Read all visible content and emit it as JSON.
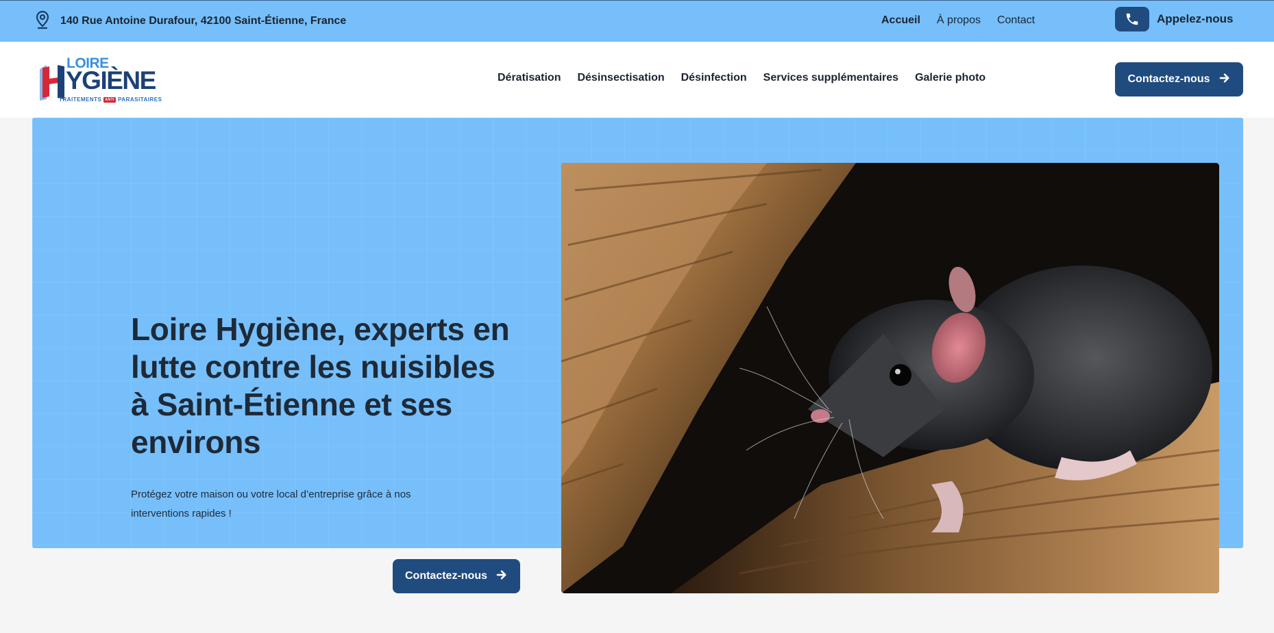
{
  "topbar": {
    "address": "140 Rue Antoine Durafour, 42100 Saint-Étienne, France",
    "nav": [
      "Accueil",
      "À propos",
      "Contact"
    ],
    "call_label": "Appelez-nous"
  },
  "logo": {
    "line1": "LOIRE",
    "line2": "YGIÈNE",
    "tag_left": "TRAITEMENTS",
    "tag_mid": "ANTI",
    "tag_right": "PARASITAIRES"
  },
  "mainnav": [
    "Dératisation",
    "Désinsectisation",
    "Désinfection",
    "Services supplémentaires",
    "Galerie photo"
  ],
  "header_cta": "Contactez-nous",
  "hero": {
    "title": "Loire Hygiène, experts en lutte contre les nuisibles à Saint-Étienne et ses environs",
    "subtitle": "Protégez votre maison ou votre local d’entreprise grâce à nos interventions rapides !",
    "cta": "Contactez-nous"
  },
  "colors": {
    "accent": "#76bffb",
    "brand_dark": "#204b7f",
    "brand_red": "#d62839"
  },
  "icons": [
    "map-pin-icon",
    "phone-icon",
    "arrow-right-icon"
  ]
}
